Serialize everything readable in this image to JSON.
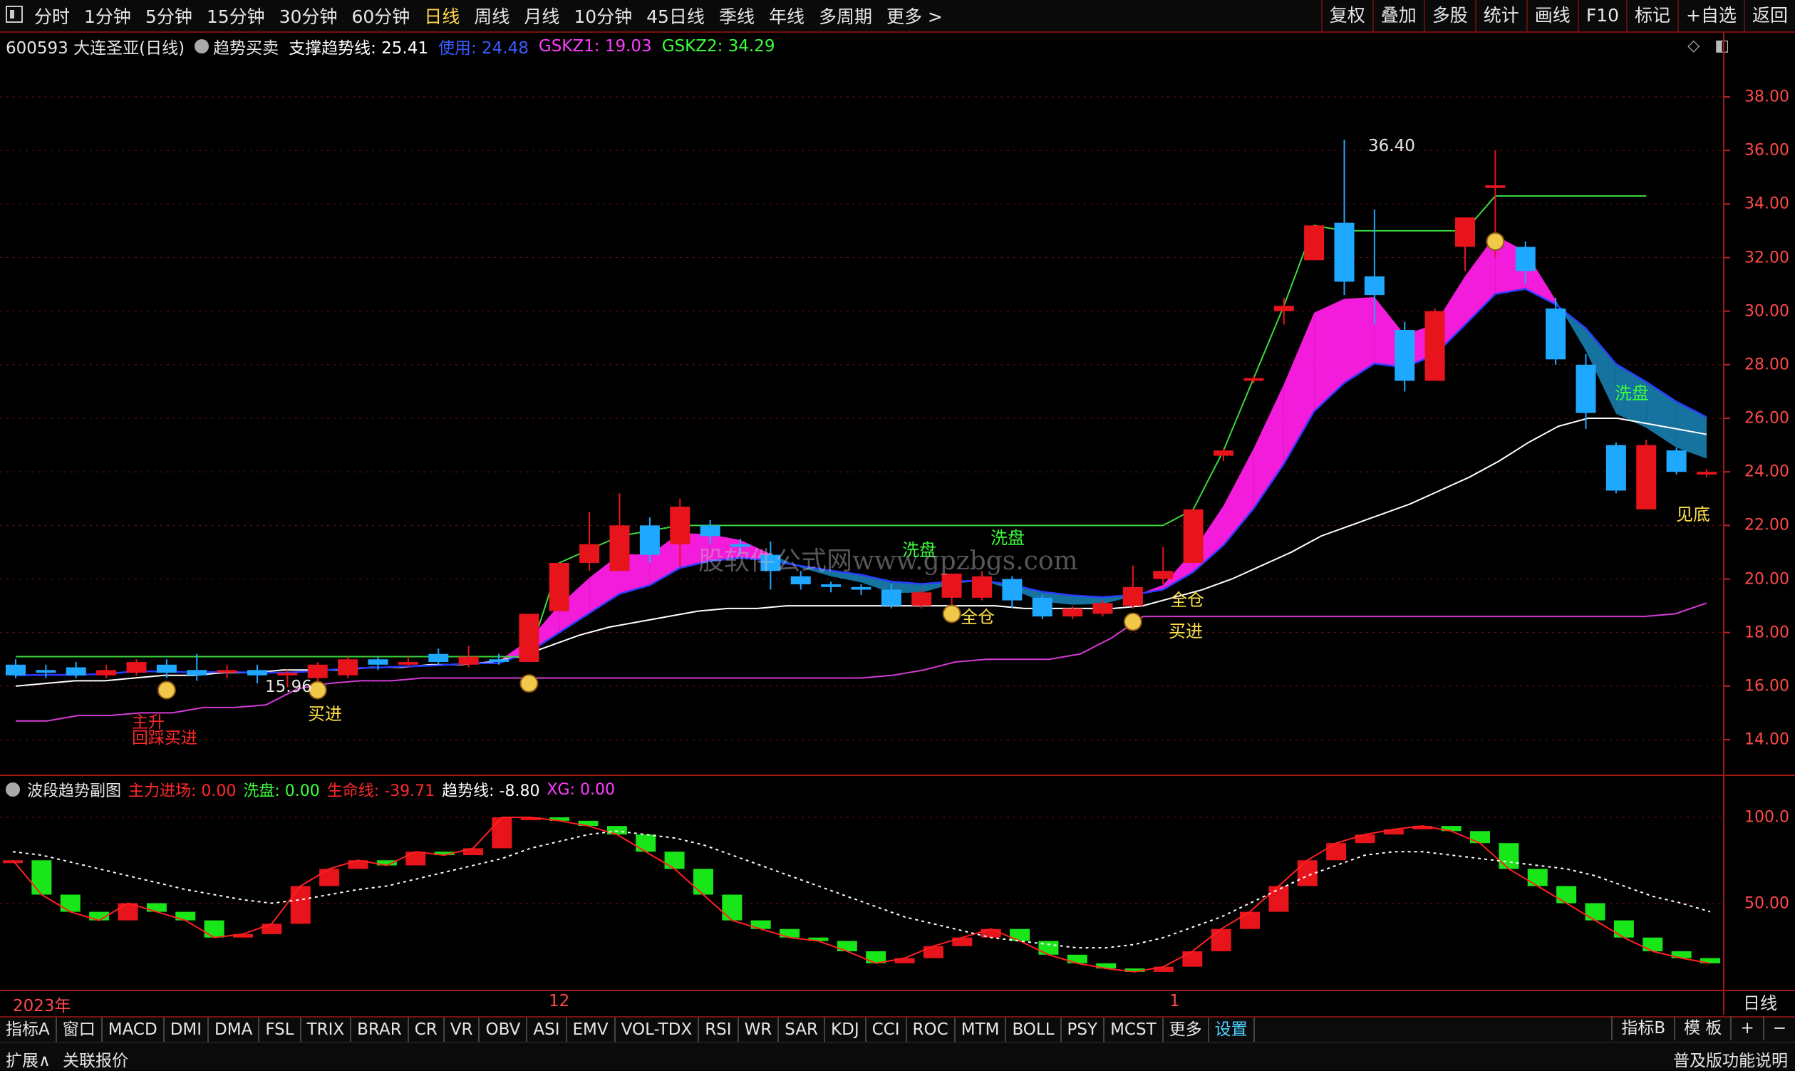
{
  "toolbar": {
    "periods": [
      "分时",
      "1分钟",
      "5分钟",
      "15分钟",
      "30分钟",
      "60分钟",
      "日线",
      "周线",
      "月线",
      "10分钟",
      "45日线",
      "季线",
      "年线",
      "多周期",
      "更多 >"
    ],
    "active_period": "日线",
    "tools": [
      "复权",
      "叠加",
      "多股",
      "统计",
      "画线",
      "F10",
      "标记",
      "+自选",
      "返回"
    ]
  },
  "main_legend": {
    "stock": "600593 大连圣亚(日线)",
    "indicator": "趋势买卖",
    "support_label": "支撑趋势线: 25.41",
    "use_label": "使用: 24.48",
    "gskz1": "GSKZ1: 19.03",
    "gskz2": "GSKZ2: 34.29"
  },
  "price_axis": [
    "38.00",
    "36.00",
    "34.00",
    "32.00",
    "30.00",
    "28.00",
    "26.00",
    "24.00",
    "22.00",
    "20.00",
    "18.00",
    "16.00",
    "14.00"
  ],
  "sub_axis": [
    "100.0",
    "50.00"
  ],
  "sub_legend": {
    "name": "波段趋势副图",
    "zhuli": "主力进场: 0.00",
    "xipan": "洗盘: 0.00",
    "shengming": "生命线: -39.71",
    "qushi": "趋势线: -8.80",
    "xg": "XG: 0.00"
  },
  "annotations": {
    "high": "36.40",
    "low": "15.96",
    "xipan": "洗盘",
    "quancang": "全仓",
    "buy": "买进",
    "bottom": "见底",
    "rise": "主升",
    "pullback_buy": "回踩买进",
    "watermark": "股软件公式网www.gpzbgs.com"
  },
  "dates": {
    "year": "2023年",
    "dec": "12",
    "jan": "1"
  },
  "day_button": "日线",
  "bottom_tabs": [
    "指标A",
    "窗口",
    "MACD",
    "DMI",
    "DMA",
    "FSL",
    "TRIX",
    "BRAR",
    "CR",
    "VR",
    "OBV",
    "ASI",
    "EMV",
    "VOL-TDX",
    "RSI",
    "WR",
    "SAR",
    "KDJ",
    "CCI",
    "ROC",
    "MTM",
    "BOLL",
    "PSY",
    "MCST",
    "更多",
    "设置"
  ],
  "bottom_right": [
    "指标B",
    "模 板",
    "+",
    "−"
  ],
  "status": {
    "left1": "扩展∧",
    "left2": "关联报价",
    "right": "普及版功能说明"
  },
  "colors": {
    "up": "#e8141c",
    "down": "#1fa8ff",
    "pink": "#ff1ee6",
    "teal": "#1779a8",
    "axis": "#ff4b4b"
  },
  "chart_data": [
    {
      "type": "candlestick",
      "title": "600593 大连圣亚(日线)",
      "ylim": [
        13,
        39
      ],
      "candles": [
        {
          "o": 16.8,
          "c": 16.4,
          "h": 17.0,
          "l": 16.3
        },
        {
          "o": 16.6,
          "c": 16.5,
          "h": 16.8,
          "l": 16.3
        },
        {
          "o": 16.7,
          "c": 16.4,
          "h": 16.9,
          "l": 16.3
        },
        {
          "o": 16.4,
          "c": 16.6,
          "h": 16.8,
          "l": 16.3
        },
        {
          "o": 16.5,
          "c": 16.9,
          "h": 17.0,
          "l": 16.4
        },
        {
          "o": 16.8,
          "c": 16.5,
          "h": 17.0,
          "l": 16.3
        },
        {
          "o": 16.6,
          "c": 16.4,
          "h": 17.2,
          "l": 16.2
        },
        {
          "o": 16.5,
          "c": 16.6,
          "h": 16.8,
          "l": 16.3
        },
        {
          "o": 16.6,
          "c": 16.4,
          "h": 16.8,
          "l": 16.1
        },
        {
          "o": 16.4,
          "c": 16.5,
          "h": 16.6,
          "l": 15.96
        },
        {
          "o": 16.3,
          "c": 16.8,
          "h": 16.9,
          "l": 16.1
        },
        {
          "o": 16.4,
          "c": 17.0,
          "h": 17.1,
          "l": 16.3
        },
        {
          "o": 17.0,
          "c": 16.8,
          "h": 17.1,
          "l": 16.6
        },
        {
          "o": 16.8,
          "c": 16.9,
          "h": 17.1,
          "l": 16.7
        },
        {
          "o": 17.2,
          "c": 16.9,
          "h": 17.4,
          "l": 16.8
        },
        {
          "o": 16.8,
          "c": 17.1,
          "h": 17.5,
          "l": 16.7
        },
        {
          "o": 17.0,
          "c": 16.9,
          "h": 17.2,
          "l": 16.8
        },
        {
          "o": 16.9,
          "c": 18.7,
          "h": 18.7,
          "l": 16.9
        },
        {
          "o": 18.8,
          "c": 20.6,
          "h": 20.6,
          "l": 18.8
        },
        {
          "o": 20.6,
          "c": 21.3,
          "h": 22.5,
          "l": 20.3
        },
        {
          "o": 20.3,
          "c": 22.0,
          "h": 23.2,
          "l": 20.3
        },
        {
          "o": 22.0,
          "c": 20.9,
          "h": 22.3,
          "l": 20.6
        },
        {
          "o": 21.3,
          "c": 22.7,
          "h": 23.0,
          "l": 20.5
        },
        {
          "o": 22.0,
          "c": 21.6,
          "h": 22.2,
          "l": 21.3
        },
        {
          "o": 21.3,
          "c": 21.2,
          "h": 21.5,
          "l": 20.9
        },
        {
          "o": 20.9,
          "c": 20.3,
          "h": 21.4,
          "l": 19.6
        },
        {
          "o": 20.1,
          "c": 19.8,
          "h": 20.3,
          "l": 19.6
        },
        {
          "o": 19.8,
          "c": 19.7,
          "h": 19.9,
          "l": 19.5
        },
        {
          "o": 19.7,
          "c": 19.6,
          "h": 19.8,
          "l": 19.4
        },
        {
          "o": 19.6,
          "c": 19.0,
          "h": 19.8,
          "l": 18.9
        },
        {
          "o": 19.0,
          "c": 19.5,
          "h": 19.6,
          "l": 18.9
        },
        {
          "o": 19.3,
          "c": 20.2,
          "h": 20.2,
          "l": 18.9
        },
        {
          "o": 19.3,
          "c": 20.1,
          "h": 20.3,
          "l": 19.2
        },
        {
          "o": 20.0,
          "c": 19.2,
          "h": 20.1,
          "l": 18.9
        },
        {
          "o": 19.3,
          "c": 18.6,
          "h": 19.4,
          "l": 18.5
        },
        {
          "o": 18.6,
          "c": 18.9,
          "h": 19.0,
          "l": 18.5
        },
        {
          "o": 18.7,
          "c": 19.1,
          "h": 19.2,
          "l": 18.6
        },
        {
          "o": 19.0,
          "c": 19.7,
          "h": 20.5,
          "l": 18.9
        },
        {
          "o": 20.0,
          "c": 20.3,
          "h": 21.2,
          "l": 19.8
        },
        {
          "o": 20.6,
          "c": 22.6,
          "h": 22.6,
          "l": 20.6
        },
        {
          "o": 24.6,
          "c": 24.8,
          "h": 24.9,
          "l": 24.4
        },
        {
          "o": 27.4,
          "c": 27.5,
          "h": 27.6,
          "l": 27.3
        },
        {
          "o": 30.0,
          "c": 30.2,
          "h": 30.5,
          "l": 29.5
        },
        {
          "o": 31.9,
          "c": 33.2,
          "h": 33.2,
          "l": 31.9
        },
        {
          "o": 33.3,
          "c": 31.1,
          "h": 36.4,
          "l": 30.6
        },
        {
          "o": 31.3,
          "c": 30.6,
          "h": 33.8,
          "l": 29.5
        },
        {
          "o": 29.3,
          "c": 27.4,
          "h": 29.6,
          "l": 27.0
        },
        {
          "o": 27.4,
          "c": 30.0,
          "h": 30.1,
          "l": 27.4
        },
        {
          "o": 32.4,
          "c": 33.5,
          "h": 33.5,
          "l": 31.5
        },
        {
          "o": 34.6,
          "c": 34.7,
          "h": 36.0,
          "l": 32.0
        },
        {
          "o": 32.4,
          "c": 31.5,
          "h": 32.6,
          "l": 31.0
        },
        {
          "o": 30.1,
          "c": 28.2,
          "h": 30.5,
          "l": 28.0
        },
        {
          "o": 28.0,
          "c": 26.2,
          "h": 28.4,
          "l": 25.6
        },
        {
          "o": 25.0,
          "c": 23.3,
          "h": 25.1,
          "l": 23.2
        },
        {
          "o": 22.6,
          "c": 25.0,
          "h": 25.2,
          "l": 22.6
        },
        {
          "o": 24.8,
          "c": 24.0,
          "h": 24.9,
          "l": 23.9
        },
        {
          "o": 23.9,
          "c": 24.0,
          "h": 24.1,
          "l": 23.8
        }
      ],
      "lines": [
        {
          "name": "白线",
          "values": [
            16.0,
            16.1,
            16.2,
            16.2,
            16.3,
            16.4,
            16.4,
            16.5,
            16.5,
            16.6,
            16.6,
            16.6,
            16.7,
            16.7,
            16.8,
            16.8,
            16.9,
            17.1,
            17.5,
            17.9,
            18.2,
            18.4,
            18.6,
            18.8,
            18.9,
            18.9,
            19.0,
            19.0,
            19.0,
            19.0,
            19.0,
            19.0,
            19.0,
            19.0,
            18.9,
            18.9,
            18.9,
            18.9,
            19.0,
            19.3,
            19.6,
            20.0,
            20.5,
            21.0,
            21.6,
            22.0,
            22.4,
            22.8,
            23.3,
            23.8,
            24.4,
            25.1,
            25.7,
            26.0,
            26.0,
            25.8,
            25.6,
            25.4
          ]
        },
        {
          "name": "紫线",
          "values": [
            14.7,
            14.7,
            14.9,
            14.9,
            15.0,
            15.0,
            15.2,
            15.2,
            15.3,
            15.9,
            16.1,
            16.2,
            16.2,
            16.3,
            16.3,
            16.3,
            16.3,
            16.3,
            16.3,
            16.3,
            16.3,
            16.3,
            16.3,
            16.3,
            16.3,
            16.3,
            16.3,
            16.3,
            16.4,
            16.6,
            16.9,
            17.0,
            17.0,
            17.0,
            17.2,
            17.8,
            18.6,
            18.6,
            18.6,
            18.6,
            18.6,
            18.6,
            18.6,
            18.6,
            18.6,
            18.6,
            18.6,
            18.6,
            18.6,
            18.6,
            18.6,
            18.6,
            18.6,
            18.7,
            19.1
          ]
        }
      ]
    },
    {
      "type": "bar",
      "title": "波段趋势副图",
      "ylim": [
        0,
        105
      ],
      "values": [
        75,
        55,
        45,
        40,
        50,
        45,
        40,
        30,
        32,
        38,
        60,
        70,
        75,
        72,
        80,
        78,
        82,
        105,
        110,
        98,
        95,
        90,
        80,
        70,
        55,
        40,
        35,
        30,
        28,
        22,
        15,
        18,
        25,
        30,
        35,
        28,
        20,
        15,
        12,
        10,
        13,
        22,
        35,
        45,
        60,
        75,
        85,
        90,
        93,
        95,
        92,
        85,
        70,
        60,
        50,
        40,
        30,
        22,
        18,
        15
      ],
      "signal_line": [
        80,
        78,
        74,
        70,
        66,
        62,
        58,
        55,
        52,
        50,
        52,
        55,
        58,
        60,
        64,
        68,
        72,
        76,
        82,
        86,
        90,
        92,
        90,
        88,
        84,
        78,
        72,
        66,
        60,
        54,
        48,
        42,
        38,
        34,
        30,
        28,
        26,
        24,
        24,
        26,
        30,
        36,
        42,
        50,
        58,
        66,
        72,
        78,
        80,
        80,
        78,
        76,
        74,
        72,
        70,
        66,
        60,
        54,
        50,
        45
      ]
    }
  ]
}
